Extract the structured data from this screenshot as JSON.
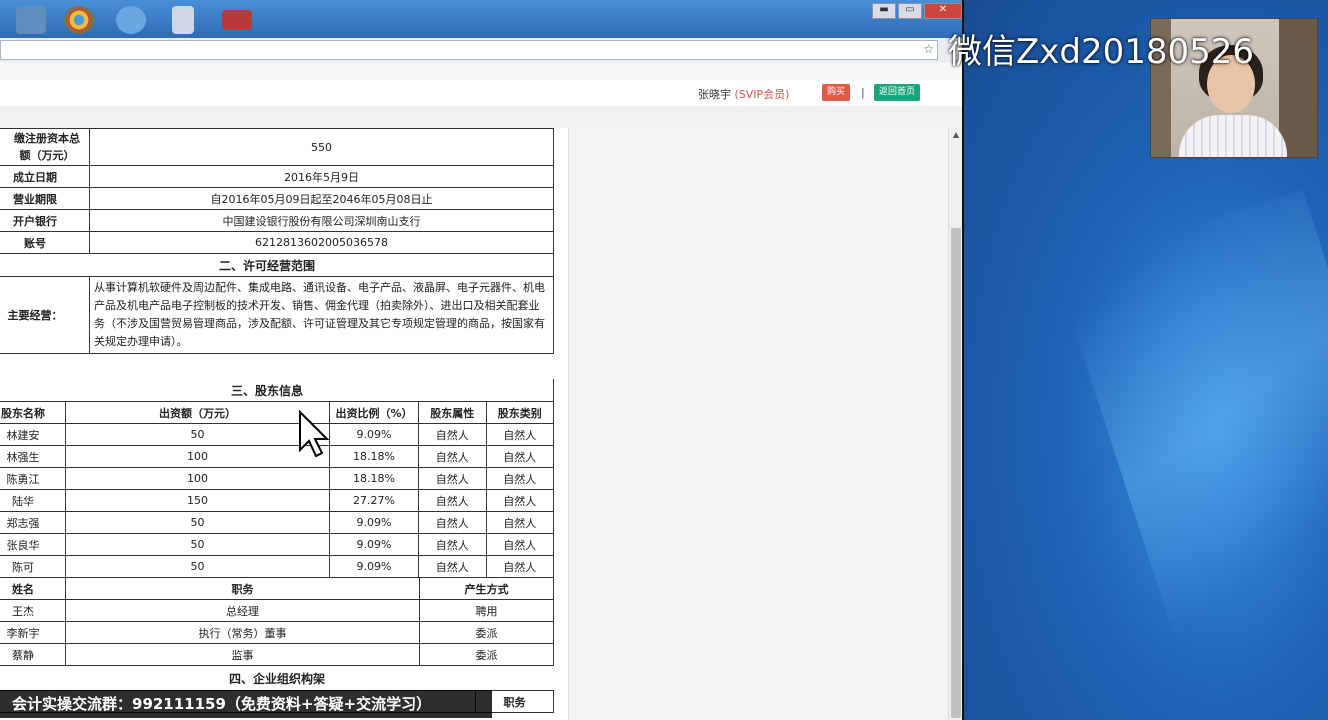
{
  "watermark": "微信Zxd20180526",
  "browser": {
    "window_controls": {
      "minimize": "▬",
      "restore": "▭",
      "close": "✕"
    },
    "star": "☆"
  },
  "header": {
    "user_name": "张晓宇",
    "vip": "(SVIP会员)",
    "buy_label": "购买",
    "separator": "|",
    "home_label": "返回首页"
  },
  "company": {
    "rows": [
      {
        "label": "缴注册资本总额（万元）",
        "value": "550"
      },
      {
        "label": "成立日期",
        "value": "2016年5月9日"
      },
      {
        "label": "营业期限",
        "value": "自2016年05月09日起至2046年05月08日止"
      },
      {
        "label": "开户银行",
        "value": "中国建设银行股份有限公司深圳南山支行"
      },
      {
        "label": "账号",
        "value": "6212813602005036578"
      }
    ],
    "scope_title": "二、许可经营范围",
    "scope_label": "主要经营：",
    "scope_text": "从事计算机软硬件及周边配件、集成电路、通讯设备、电子产品、液晶屏、电子元器件、机电产品及机电产品电子控制板的技术开发、销售、佣金代理（拍卖除外）、进出口及相关配套业务（不涉及国营贸易管理商品，涉及配额、许可证管理及其它专项规定管理的商品，按国家有关规定办理申请）。"
  },
  "shareholders": {
    "title": "三、股东信息",
    "headers": [
      "股东名称",
      "出资额（万元）",
      "出资比例（%）",
      "股东属性",
      "股东类别"
    ],
    "rows": [
      [
        "林建安",
        "50",
        "9.09%",
        "自然人",
        "自然人"
      ],
      [
        "林强生",
        "100",
        "18.18%",
        "自然人",
        "自然人"
      ],
      [
        "陈勇江",
        "100",
        "18.18%",
        "自然人",
        "自然人"
      ],
      [
        "陆华",
        "150",
        "27.27%",
        "自然人",
        "自然人"
      ],
      [
        "郑志强",
        "50",
        "9.09%",
        "自然人",
        "自然人"
      ],
      [
        "张良华",
        "50",
        "9.09%",
        "自然人",
        "自然人"
      ],
      [
        "陈可",
        "50",
        "9.09%",
        "自然人",
        "自然人"
      ]
    ]
  },
  "officers": {
    "headers": [
      "姓名",
      "职务",
      "产生方式"
    ],
    "rows": [
      [
        "王杰",
        "总经理",
        "聘用"
      ],
      [
        "李新宇",
        "执行（常务）董事",
        "委派"
      ],
      [
        "蔡静",
        "监事",
        "委派"
      ]
    ]
  },
  "org": {
    "title": "四、企业组织构架",
    "partial_header": "职务"
  },
  "caption": "会计实操交流群：992111159（免费资料+答疑+交流学习）"
}
